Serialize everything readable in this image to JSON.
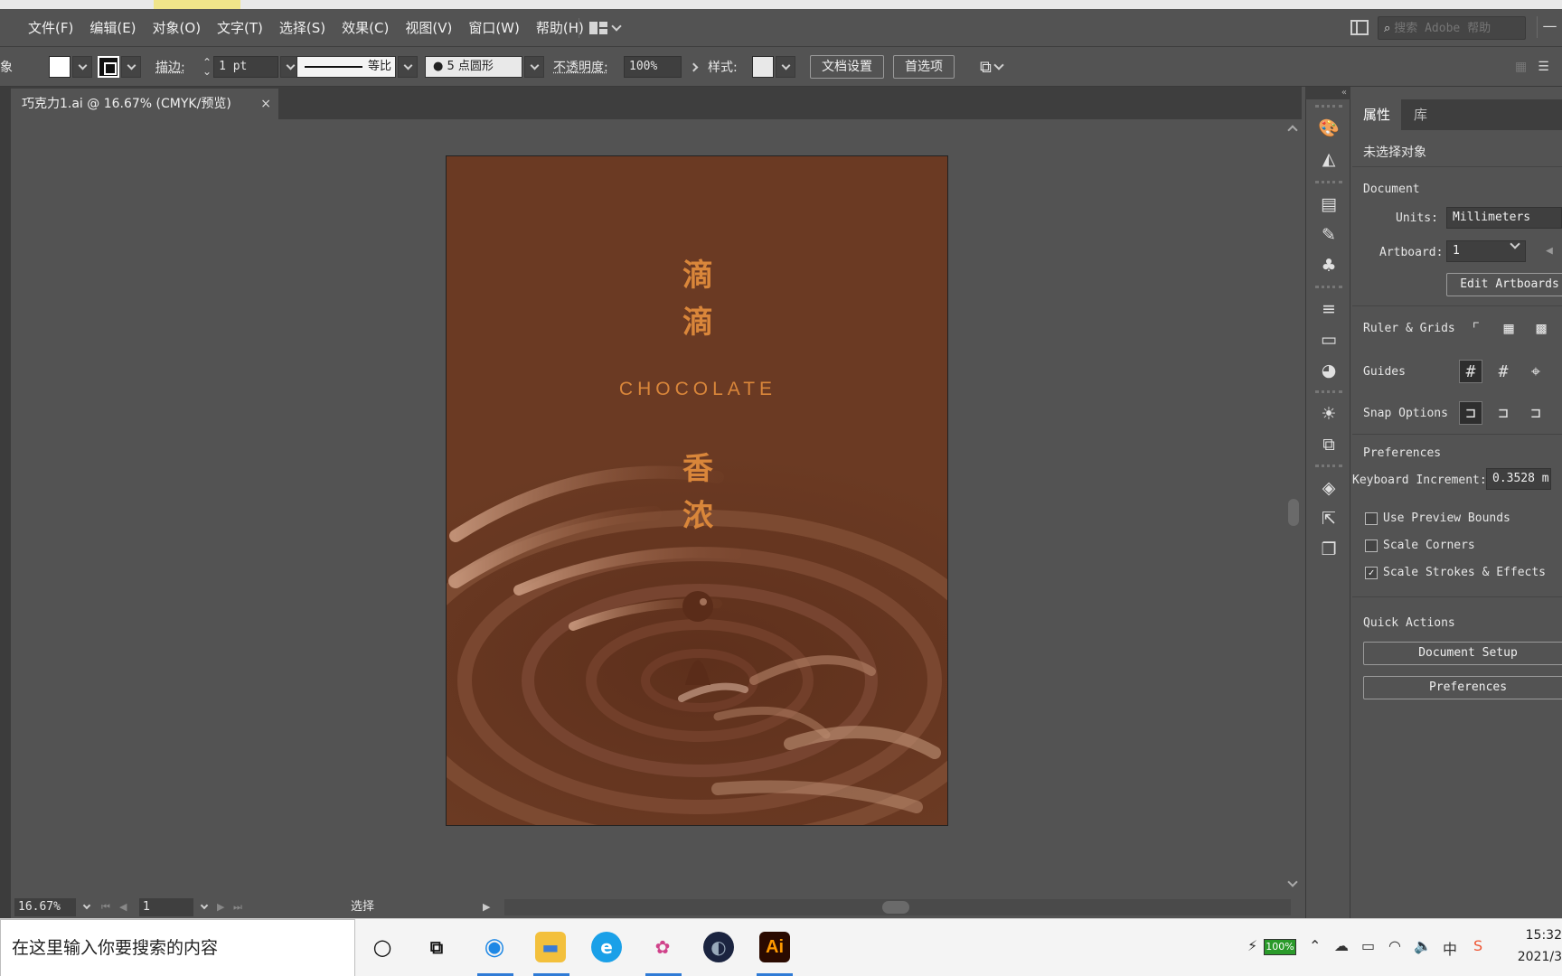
{
  "menu": {
    "items": [
      "文件(F)",
      "编辑(E)",
      "对象(O)",
      "文字(T)",
      "选择(S)",
      "效果(C)",
      "视图(V)",
      "窗口(W)",
      "帮助(H)"
    ],
    "search_placeholder": "搜索 Adobe 帮助"
  },
  "control": {
    "left_cut_label": "象",
    "stroke_label": "描边:",
    "stroke_weight": "1 pt",
    "stroke_profile": "等比",
    "brush": "5 点圆形",
    "brush_dot": "●",
    "opacity_label": "不透明度:",
    "opacity_value": "100%",
    "style_label": "样式:",
    "doc_setup_button": "文档设置",
    "prefs_button": "首选项"
  },
  "document": {
    "tab_title": "巧克力1.ai @ 16.67% (CMYK/预览)",
    "close_glyph": "×"
  },
  "artboard": {
    "title_chars_top": [
      "滴",
      "滴"
    ],
    "subtitle": "CHOCOLATE",
    "title_chars_bottom": [
      "香",
      "浓"
    ],
    "background_color": "#6b3a23",
    "text_color": "#d9863a"
  },
  "status": {
    "zoom": "16.67%",
    "page": "1",
    "tool": "选择"
  },
  "panel": {
    "tabs": [
      "属性",
      "库"
    ],
    "no_selection": "未选择对象",
    "document_heading": "Document",
    "units_label": "Units:",
    "units_value": "Millimeters",
    "artboard_label": "Artboard:",
    "artboard_value": "1",
    "edit_artboards_button": "Edit Artboards",
    "ruler_grids_label": "Ruler & Grids",
    "guides_label": "Guides",
    "snap_options_label": "Snap Options",
    "preferences_heading": "Preferences",
    "keyboard_increment_label": "Keyboard Increment:",
    "keyboard_increment_value": "0.3528 m",
    "use_preview_bounds": "Use Preview Bounds",
    "scale_corners": "Scale Corners",
    "scale_strokes": "Scale Strokes & Effects",
    "quick_actions_heading": "Quick Actions",
    "document_setup_button": "Document Setup",
    "preferences_button": "Preferences"
  },
  "taskbar": {
    "search_text": "在这里输入你要搜索的内容",
    "ai_label": "Ai",
    "battery": "100%",
    "ime": "中",
    "time": "15:32",
    "date": "2021/3"
  }
}
